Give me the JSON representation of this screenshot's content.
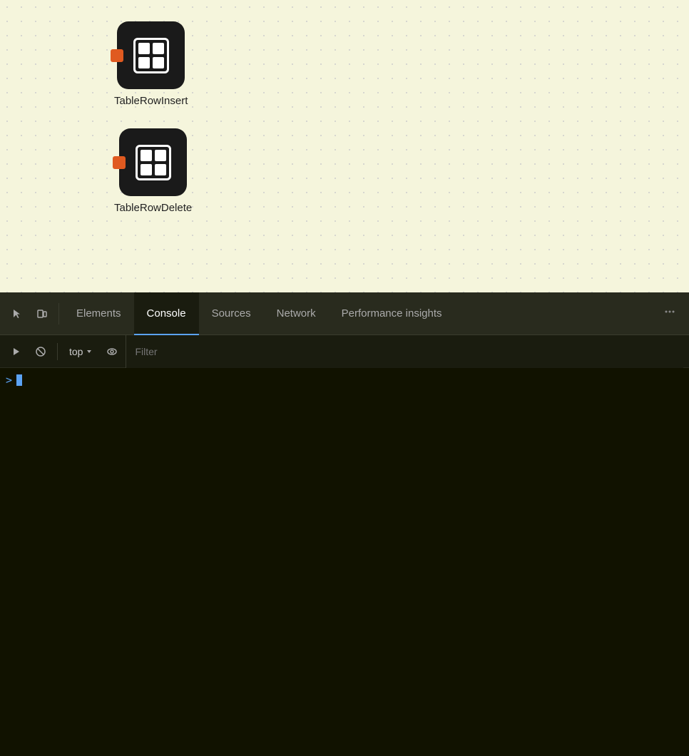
{
  "canvas": {
    "nodes": [
      {
        "id": "node-1",
        "label": "TableRowInsert",
        "icon": "table-icon"
      },
      {
        "id": "node-2",
        "label": "TableRowDelete",
        "icon": "table-icon"
      }
    ]
  },
  "devtools": {
    "tabs": [
      {
        "id": "elements",
        "label": "Elements",
        "active": false
      },
      {
        "id": "console",
        "label": "Console",
        "active": true
      },
      {
        "id": "sources",
        "label": "Sources",
        "active": false
      },
      {
        "id": "network",
        "label": "Network",
        "active": false
      },
      {
        "id": "performance",
        "label": "Performance insights",
        "active": false
      }
    ],
    "toolbar": {
      "context": "top",
      "filter_placeholder": "Filter"
    },
    "console": {
      "prompt_symbol": ">"
    }
  }
}
